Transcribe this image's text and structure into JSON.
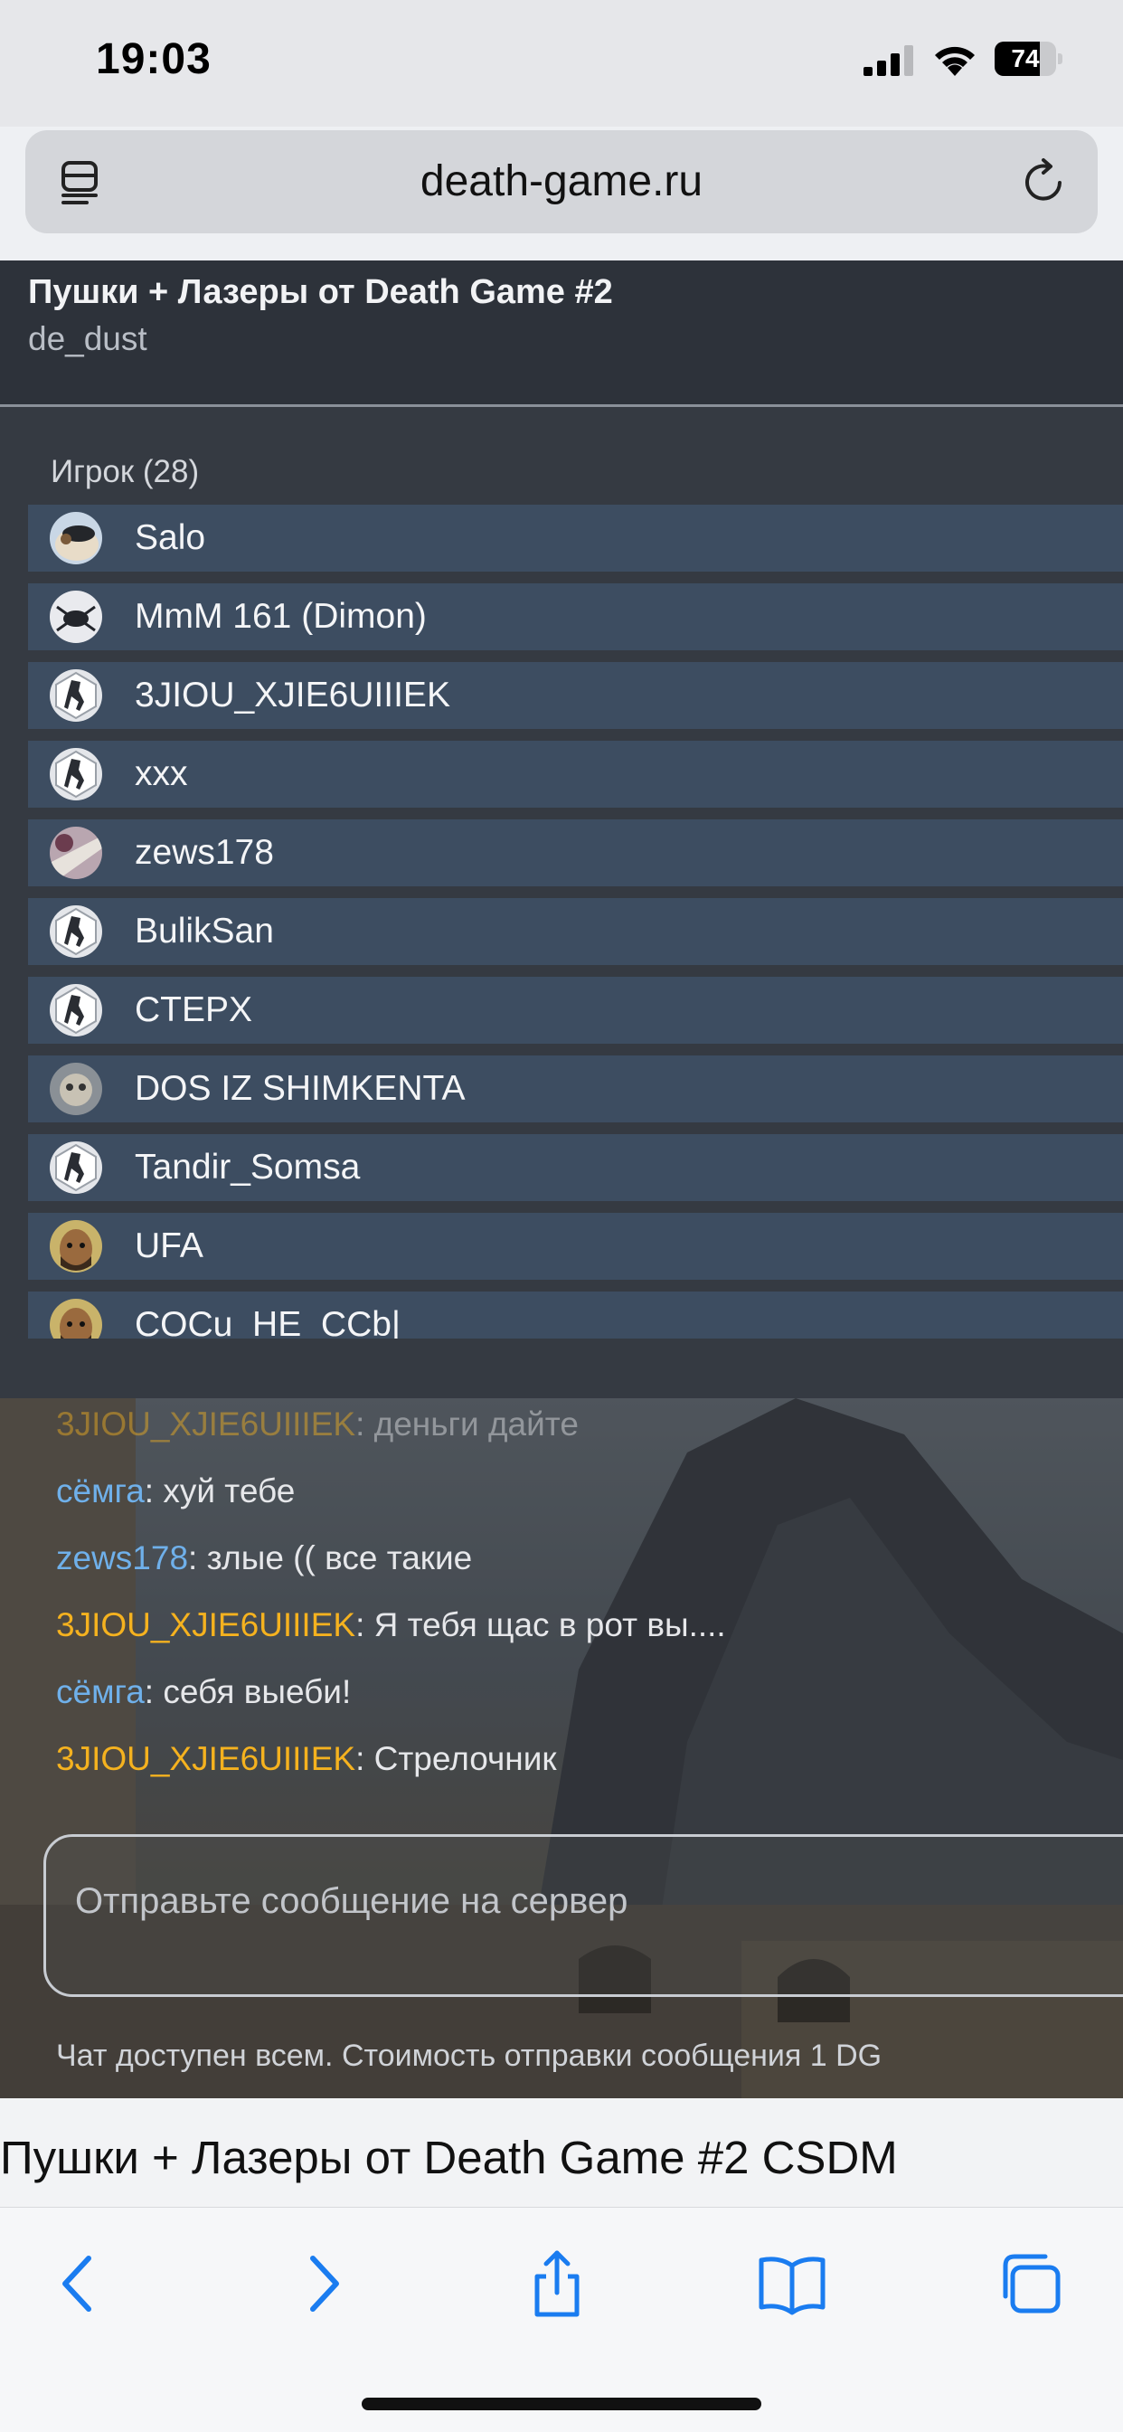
{
  "status_bar": {
    "time": "19:03",
    "battery": "74",
    "battery_level": 0.74,
    "icons": [
      "signal-icon",
      "wifi-icon",
      "battery-icon"
    ]
  },
  "browser": {
    "url": "death-game.ru",
    "left_icon": "tabs-overview-icon",
    "right_icon": "reload-icon"
  },
  "server": {
    "title": "Пушки + Лазеры от Death Game #2",
    "map": "de_dust"
  },
  "players": {
    "heading": "Игрок (28)",
    "list": [
      {
        "name": "Salo",
        "avatar": "bird"
      },
      {
        "name": "MmM 161 (Dimon)",
        "avatar": "spider"
      },
      {
        "name": "3JIOU_XJIE6UIIIEK",
        "avatar": "cs-logo"
      },
      {
        "name": "xxx",
        "avatar": "cs-logo"
      },
      {
        "name": "zews178",
        "avatar": "photo"
      },
      {
        "name": "BulikSan",
        "avatar": "cs-logo"
      },
      {
        "name": "CTEPX",
        "avatar": "cs-logo"
      },
      {
        "name": "DOS IZ SHIMKENTA",
        "avatar": "face"
      },
      {
        "name": "Tandir_Somsa",
        "avatar": "cs-logo"
      },
      {
        "name": "UFA",
        "avatar": "beard"
      },
      {
        "name": "COCu_HE_CCb|",
        "avatar": "beard"
      }
    ]
  },
  "chat": {
    "messages": [
      {
        "author": "3JIOU_XJIE6UIIIEK",
        "text": ": деньги дайте",
        "color": "orange"
      },
      {
        "author": "сёмга",
        "text": ": хуй тебе",
        "color": "blue"
      },
      {
        "author": "zews178",
        "text": ": злые (( все такие",
        "color": "blue"
      },
      {
        "author": "3JIOU_XJIE6UIIIEK",
        "text": ": Я тебя щас в рот вы....",
        "color": "orange"
      },
      {
        "author": "сёмга",
        "text": ": себя выеби!",
        "color": "blue"
      },
      {
        "author": "3JIOU_XJIE6UIIIEK",
        "text": ": Стрелочник",
        "color": "orange"
      }
    ],
    "input_placeholder": "Отправьте сообщение на сервер",
    "note": "Чат доступен всем. Стоимость отправки сообщения 1 DG"
  },
  "page": {
    "heading": "Пушки + Лазеры от Death Game #2 CSDM"
  },
  "toolbar": {
    "buttons": [
      "back-icon",
      "forward-icon",
      "share-icon",
      "bookmarks-icon",
      "tabs-icon"
    ]
  },
  "colors": {
    "name_orange": "#f5b21f",
    "name_blue": "#6fb0ea",
    "row_bg": "#3d4d61",
    "panel_bg": "#353a42",
    "ios_blue": "#1a7cf0"
  }
}
